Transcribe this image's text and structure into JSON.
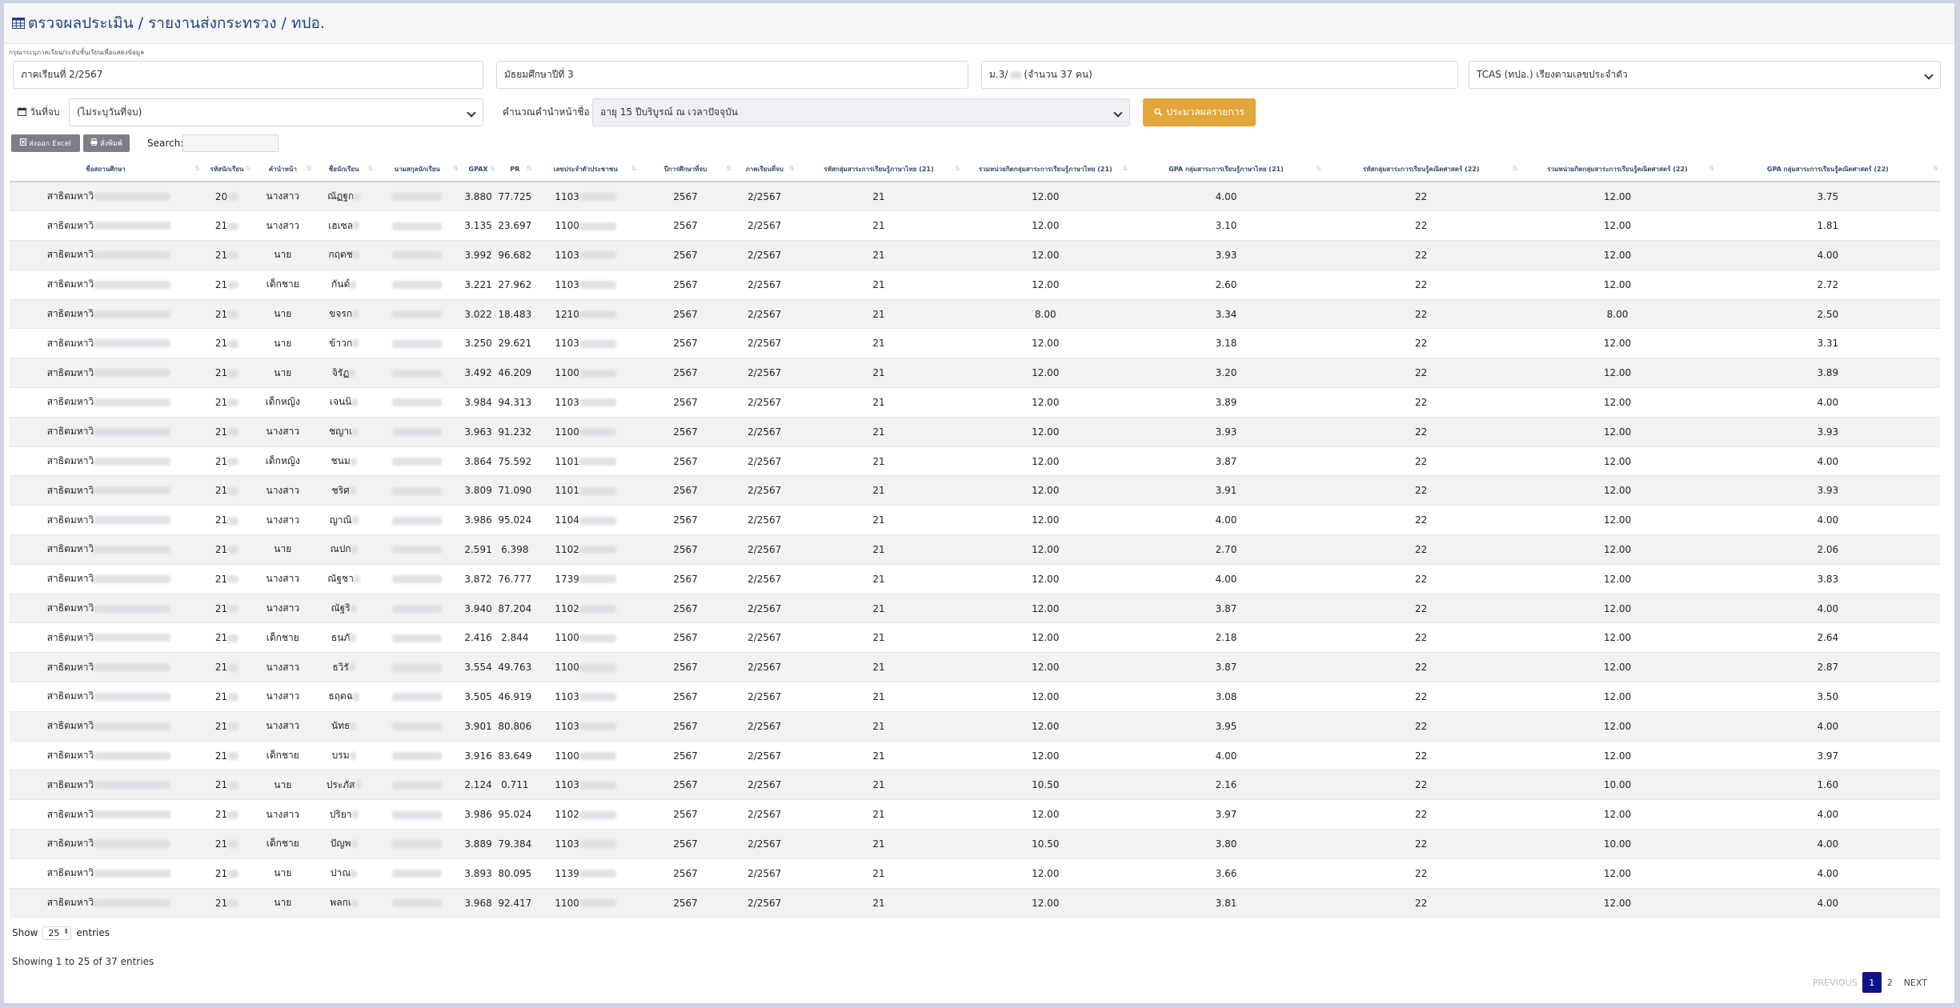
{
  "header": {
    "title": "ตรวจผลประเมิน / รายงานส่งกระทรวง / ทปอ."
  },
  "hint": "กรุณาระบุภาคเรียน/ระดับชั้นเรียนเพื่อแสดงข้อมูล",
  "filters": {
    "semester": "ภาคเรียนที่ 2/2567",
    "grade": "มัธยมศึกษาปีที่ 3",
    "class_prefix": "ม.3/",
    "class_count": "(จำนวน 37 คน)",
    "report_type": "TCAS (ทปอ.) เรียงตามเลขประจำตัว",
    "end_date_label": "วันที่จบ",
    "end_date_value": "(ไม่ระบุวันที่จบ)",
    "prefix_calc_label": "คำนวณคำนำหน้าชื่อ",
    "prefix_calc_value": "อายุ 15 ปีบริบูรณ์ ณ เวลาปัจจุบัน",
    "process_button": "ประมวลผลรายการ"
  },
  "toolbar": {
    "excel": "ส่งออก Excel",
    "print": "สั่งพิมพ์",
    "search_label": "Search:"
  },
  "table": {
    "headers": [
      "ชื่อสถานศึกษา",
      "รหัสนักเรียน",
      "คำนำหน้า",
      "ชื่อนักเรียน",
      "นามสกุลนักเรียน",
      "GPAX",
      "PR",
      "เลขประจำตัวประชาชน",
      "ปีการศึกษาที่จบ",
      "ภาคเรียนที่จบ",
      "รหัสกลุ่มสาระการเรียนรู้ภาษาไทย (21)",
      "รวมหน่วยกิตกลุ่มสาระการเรียนรู้ภาษาไทย (21)",
      "GPA กลุ่มสาระการเรียนรู้ภาษาไทย (21)",
      "รหัสกลุ่มสาระการเรียนรู้คณิตศาสตร์ (22)",
      "รวมหน่วยกิตกลุ่มสาระการเรียนรู้คณิตศาสตร์ (22)",
      "GPA กลุ่มสาระการเรียนรู้คณิตศาสตร์ (22)"
    ],
    "rows": [
      {
        "school": "สาธิตมหาวิ",
        "id": "20",
        "prefix": "นางสาว",
        "name": "ณัฏฐก",
        "gpax": "3.880",
        "pr": "77.725",
        "cid": "1103",
        "year": "2567",
        "sem": "2/2567",
        "c21": "21",
        "u21": "12.00",
        "g21": "4.00",
        "c22": "22",
        "u22": "12.00",
        "g22": "3.75"
      },
      {
        "school": "สาธิตมหาวิ",
        "id": "21",
        "prefix": "นางสาว",
        "name": "เฮเซล",
        "gpax": "3.135",
        "pr": "23.697",
        "cid": "1100",
        "year": "2567",
        "sem": "2/2567",
        "c21": "21",
        "u21": "12.00",
        "g21": "3.10",
        "c22": "22",
        "u22": "12.00",
        "g22": "1.81"
      },
      {
        "school": "สาธิตมหาวิ",
        "id": "21",
        "prefix": "นาย",
        "name": "กฤตช",
        "gpax": "3.992",
        "pr": "96.682",
        "cid": "1103",
        "year": "2567",
        "sem": "2/2567",
        "c21": "21",
        "u21": "12.00",
        "g21": "3.93",
        "c22": "22",
        "u22": "12.00",
        "g22": "4.00"
      },
      {
        "school": "สาธิตมหาวิ",
        "id": "21",
        "prefix": "เด็กชาย",
        "name": "กันต์",
        "gpax": "3.221",
        "pr": "27.962",
        "cid": "1103",
        "year": "2567",
        "sem": "2/2567",
        "c21": "21",
        "u21": "12.00",
        "g21": "2.60",
        "c22": "22",
        "u22": "12.00",
        "g22": "2.72"
      },
      {
        "school": "สาธิตมหาวิ",
        "id": "21",
        "prefix": "นาย",
        "name": "ขจรก",
        "gpax": "3.022",
        "pr": "18.483",
        "cid": "1210",
        "year": "2567",
        "sem": "2/2567",
        "c21": "21",
        "u21": "8.00",
        "g21": "3.34",
        "c22": "22",
        "u22": "8.00",
        "g22": "2.50"
      },
      {
        "school": "สาธิตมหาวิ",
        "id": "21",
        "prefix": "นาย",
        "name": "ข้าวก",
        "gpax": "3.250",
        "pr": "29.621",
        "cid": "1103",
        "year": "2567",
        "sem": "2/2567",
        "c21": "21",
        "u21": "12.00",
        "g21": "3.18",
        "c22": "22",
        "u22": "12.00",
        "g22": "3.31"
      },
      {
        "school": "สาธิตมหาวิ",
        "id": "21",
        "prefix": "นาย",
        "name": "จิรัฏ",
        "gpax": "3.492",
        "pr": "46.209",
        "cid": "1100",
        "year": "2567",
        "sem": "2/2567",
        "c21": "21",
        "u21": "12.00",
        "g21": "3.20",
        "c22": "22",
        "u22": "12.00",
        "g22": "3.89"
      },
      {
        "school": "สาธิตมหาวิ",
        "id": "21",
        "prefix": "เด็กหญิง",
        "name": "เจนนิ",
        "gpax": "3.984",
        "pr": "94.313",
        "cid": "1103",
        "year": "2567",
        "sem": "2/2567",
        "c21": "21",
        "u21": "12.00",
        "g21": "3.89",
        "c22": "22",
        "u22": "12.00",
        "g22": "4.00"
      },
      {
        "school": "สาธิตมหาวิ",
        "id": "21",
        "prefix": "นางสาว",
        "name": "ชญาเ",
        "gpax": "3.963",
        "pr": "91.232",
        "cid": "1100",
        "year": "2567",
        "sem": "2/2567",
        "c21": "21",
        "u21": "12.00",
        "g21": "3.93",
        "c22": "22",
        "u22": "12.00",
        "g22": "3.93"
      },
      {
        "school": "สาธิตมหาวิ",
        "id": "21",
        "prefix": "เด็กหญิง",
        "name": "ชนม",
        "gpax": "3.864",
        "pr": "75.592",
        "cid": "1101",
        "year": "2567",
        "sem": "2/2567",
        "c21": "21",
        "u21": "12.00",
        "g21": "3.87",
        "c22": "22",
        "u22": "12.00",
        "g22": "4.00"
      },
      {
        "school": "สาธิตมหาวิ",
        "id": "21",
        "prefix": "นางสาว",
        "name": "ชริศ",
        "gpax": "3.809",
        "pr": "71.090",
        "cid": "1101",
        "year": "2567",
        "sem": "2/2567",
        "c21": "21",
        "u21": "12.00",
        "g21": "3.91",
        "c22": "22",
        "u22": "12.00",
        "g22": "3.93"
      },
      {
        "school": "สาธิตมหาวิ",
        "id": "21",
        "prefix": "นางสาว",
        "name": "ญาณิ",
        "gpax": "3.986",
        "pr": "95.024",
        "cid": "1104",
        "year": "2567",
        "sem": "2/2567",
        "c21": "21",
        "u21": "12.00",
        "g21": "4.00",
        "c22": "22",
        "u22": "12.00",
        "g22": "4.00"
      },
      {
        "school": "สาธิตมหาวิ",
        "id": "21",
        "prefix": "นาย",
        "name": "ณปก",
        "gpax": "2.591",
        "pr": "6.398",
        "cid": "1102",
        "year": "2567",
        "sem": "2/2567",
        "c21": "21",
        "u21": "12.00",
        "g21": "2.70",
        "c22": "22",
        "u22": "12.00",
        "g22": "2.06"
      },
      {
        "school": "สาธิตมหาวิ",
        "id": "21",
        "prefix": "นางสาว",
        "name": "ณัฐชา",
        "gpax": "3.872",
        "pr": "76.777",
        "cid": "1739",
        "year": "2567",
        "sem": "2/2567",
        "c21": "21",
        "u21": "12.00",
        "g21": "4.00",
        "c22": "22",
        "u22": "12.00",
        "g22": "3.83"
      },
      {
        "school": "สาธิตมหาวิ",
        "id": "21",
        "prefix": "นางสาว",
        "name": "ณัฐริ",
        "gpax": "3.940",
        "pr": "87.204",
        "cid": "1102",
        "year": "2567",
        "sem": "2/2567",
        "c21": "21",
        "u21": "12.00",
        "g21": "3.87",
        "c22": "22",
        "u22": "12.00",
        "g22": "4.00"
      },
      {
        "school": "สาธิตมหาวิ",
        "id": "21",
        "prefix": "เด็กชาย",
        "name": "ธนภั",
        "gpax": "2.416",
        "pr": "2.844",
        "cid": "1100",
        "year": "2567",
        "sem": "2/2567",
        "c21": "21",
        "u21": "12.00",
        "g21": "2.18",
        "c22": "22",
        "u22": "12.00",
        "g22": "2.64"
      },
      {
        "school": "สาธิตมหาวิ",
        "id": "21",
        "prefix": "นางสาว",
        "name": "ธวิรั",
        "gpax": "3.554",
        "pr": "49.763",
        "cid": "1100",
        "year": "2567",
        "sem": "2/2567",
        "c21": "21",
        "u21": "12.00",
        "g21": "3.87",
        "c22": "22",
        "u22": "12.00",
        "g22": "2.87"
      },
      {
        "school": "สาธิตมหาวิ",
        "id": "21",
        "prefix": "นางสาว",
        "name": "ธฤตฉ",
        "gpax": "3.505",
        "pr": "46.919",
        "cid": "1103",
        "year": "2567",
        "sem": "2/2567",
        "c21": "21",
        "u21": "12.00",
        "g21": "3.08",
        "c22": "22",
        "u22": "12.00",
        "g22": "3.50"
      },
      {
        "school": "สาธิตมหาวิ",
        "id": "21",
        "prefix": "นางสาว",
        "name": "นัทธ",
        "gpax": "3.901",
        "pr": "80.806",
        "cid": "1103",
        "year": "2567",
        "sem": "2/2567",
        "c21": "21",
        "u21": "12.00",
        "g21": "3.95",
        "c22": "22",
        "u22": "12.00",
        "g22": "4.00"
      },
      {
        "school": "สาธิตมหาวิ",
        "id": "21",
        "prefix": "เด็กชาย",
        "name": "บรม",
        "gpax": "3.916",
        "pr": "83.649",
        "cid": "1100",
        "year": "2567",
        "sem": "2/2567",
        "c21": "21",
        "u21": "12.00",
        "g21": "4.00",
        "c22": "22",
        "u22": "12.00",
        "g22": "3.97"
      },
      {
        "school": "สาธิตมหาวิ",
        "id": "21",
        "prefix": "นาย",
        "name": "ประภัส",
        "gpax": "2.124",
        "pr": "0.711",
        "cid": "1103",
        "year": "2567",
        "sem": "2/2567",
        "c21": "21",
        "u21": "10.50",
        "g21": "2.16",
        "c22": "22",
        "u22": "10.00",
        "g22": "1.60"
      },
      {
        "school": "สาธิตมหาวิ",
        "id": "21",
        "prefix": "นางสาว",
        "name": "ปริยา",
        "gpax": "3.986",
        "pr": "95.024",
        "cid": "1102",
        "year": "2567",
        "sem": "2/2567",
        "c21": "21",
        "u21": "12.00",
        "g21": "3.97",
        "c22": "22",
        "u22": "12.00",
        "g22": "4.00"
      },
      {
        "school": "สาธิตมหาวิ",
        "id": "21",
        "prefix": "เด็กชาย",
        "name": "ปัญพ",
        "gpax": "3.889",
        "pr": "79.384",
        "cid": "1103",
        "year": "2567",
        "sem": "2/2567",
        "c21": "21",
        "u21": "10.50",
        "g21": "3.80",
        "c22": "22",
        "u22": "10.00",
        "g22": "4.00"
      },
      {
        "school": "สาธิตมหาวิ",
        "id": "21",
        "prefix": "นาย",
        "name": "ปาณ",
        "gpax": "3.893",
        "pr": "80.095",
        "cid": "1139",
        "year": "2567",
        "sem": "2/2567",
        "c21": "21",
        "u21": "12.00",
        "g21": "3.66",
        "c22": "22",
        "u22": "12.00",
        "g22": "4.00"
      },
      {
        "school": "สาธิตมหาวิ",
        "id": "21",
        "prefix": "นาย",
        "name": "พลกเ",
        "gpax": "3.968",
        "pr": "92.417",
        "cid": "1100",
        "year": "2567",
        "sem": "2/2567",
        "c21": "21",
        "u21": "12.00",
        "g21": "3.81",
        "c22": "22",
        "u22": "12.00",
        "g22": "4.00"
      }
    ]
  },
  "footer": {
    "show_label": "Show",
    "show_value": "25",
    "entries_label": "entries",
    "info": "Showing 1 to 25 of 37 entries",
    "previous": "PREVIOUS",
    "page1": "1",
    "page2": "2",
    "next": "NEXT"
  }
}
